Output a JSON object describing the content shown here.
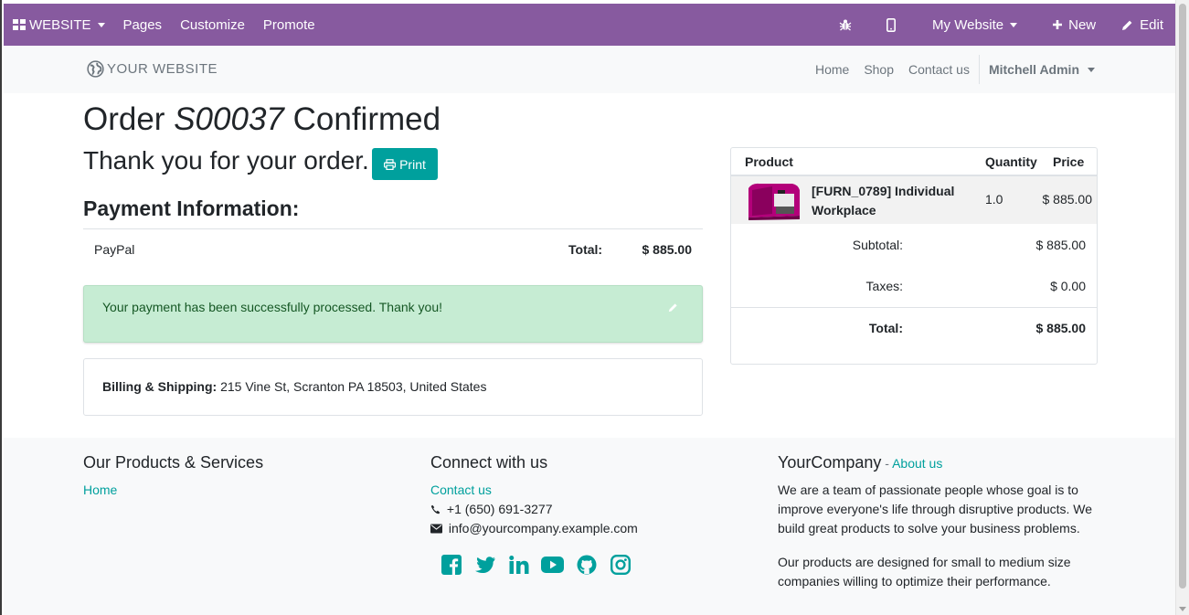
{
  "admin_bar": {
    "website_label": "WEBSITE",
    "pages_label": "Pages",
    "customize_label": "Customize",
    "promote_label": "Promote",
    "my_website_label": "My Website",
    "new_label": "New",
    "edit_label": "Edit"
  },
  "header": {
    "logo_text": "YOUR WEBSITE",
    "nav": [
      "Home",
      "Shop",
      "Contact us"
    ],
    "user": "Mitchell Admin"
  },
  "order": {
    "title_prefix": "Order",
    "order_ref": "S00037",
    "title_suffix": "Confirmed",
    "thanks": "Thank you for your order.",
    "print_label": "Print",
    "payment_heading": "Payment Information:",
    "payment_method": "PayPal",
    "total_label": "Total:",
    "total_value": "$ 885.00",
    "alert": "Your payment has been successfully processed. Thank you!",
    "address_label": "Billing & Shipping:",
    "address": "215 Vine St, Scranton PA 18503, United States"
  },
  "summary": {
    "col_product": "Product",
    "col_quantity": "Quantity",
    "col_price": "Price",
    "items": [
      {
        "name": "[FURN_0789] Individual Workplace",
        "quantity": "1.0",
        "price": "$ 885.00"
      }
    ],
    "subtotal_label": "Subtotal:",
    "subtotal_value": "$ 885.00",
    "taxes_label": "Taxes:",
    "taxes_value": "$ 0.00",
    "total_label": "Total:",
    "total_value": "$ 885.00"
  },
  "footer": {
    "col1_title": "Our Products & Services",
    "col1_link": "Home",
    "col2_title": "Connect with us",
    "col2_link": "Contact us",
    "phone": "+1 (650) 691-3277",
    "email": "info@yourcompany.example.com",
    "col3_title": "YourCompany",
    "col3_sep": " - ",
    "col3_link": "About us",
    "para1": "We are a team of passionate people whose goal is to improve everyone's life through disruptive products. We build great products to solve your business problems.",
    "para2": "Our products are designed for small to medium size companies willing to optimize their performance."
  },
  "colors": {
    "admin_bar": "#875a9f",
    "accent": "#00a09d",
    "alert_bg": "#c6ecd3",
    "alert_text": "#155724",
    "product_magenta": "#b3007a"
  }
}
